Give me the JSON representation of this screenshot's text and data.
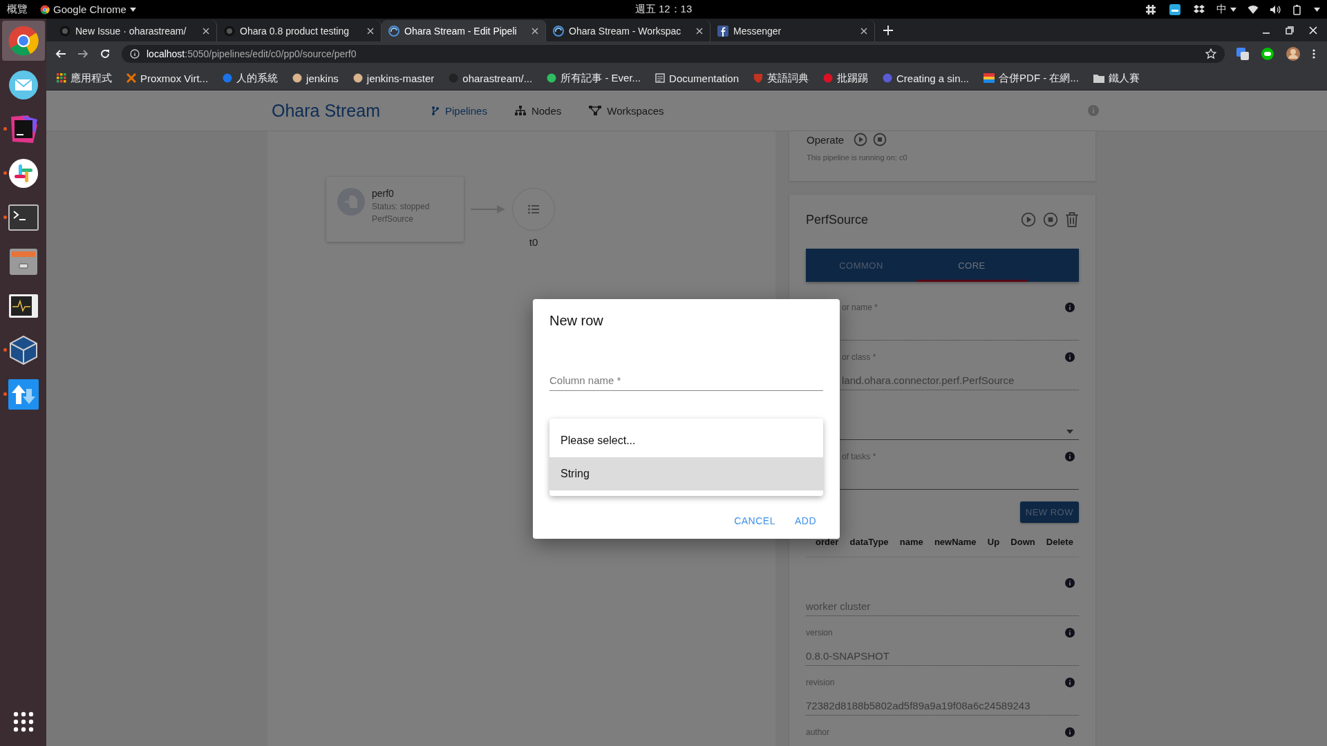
{
  "system_bar": {
    "activities": "概覽",
    "app_menu": "Google Chrome",
    "clock": "週五 12：13",
    "input_method": "中"
  },
  "browser": {
    "tabs": [
      {
        "title": "New Issue · oharastream/",
        "selected": false
      },
      {
        "title": "Ohara 0.8 product testing",
        "selected": false
      },
      {
        "title": "Ohara Stream - Edit Pipeli",
        "selected": true
      },
      {
        "title": "Ohara Stream - Workspac",
        "selected": false
      },
      {
        "title": "Messenger",
        "selected": false
      }
    ],
    "url_host": "localhost",
    "url_path": ":5050/pipelines/edit/c0/pp0/source/perf0",
    "bookmarks": [
      "應用程式",
      "Proxmox Virt...",
      "人的系統",
      "jenkins",
      "jenkins-master",
      "oharastream/...",
      "所有記事 - Ever...",
      "Documentation",
      "英語詞典",
      "批踢踢",
      "Creating a sin...",
      "合併PDF - 在網...",
      "鐵人賽"
    ]
  },
  "dock": {
    "apps": [
      {
        "kind": "chrome",
        "running": false,
        "selected": true
      },
      {
        "kind": "mail",
        "running": false,
        "selected": false
      },
      {
        "kind": "intellij",
        "running": true,
        "selected": false
      },
      {
        "kind": "slack",
        "running": true,
        "selected": false
      },
      {
        "kind": "terminal",
        "running": true,
        "selected": false
      },
      {
        "kind": "files",
        "running": false,
        "selected": false
      },
      {
        "kind": "monitor",
        "running": false,
        "selected": false
      },
      {
        "kind": "virtualbox",
        "running": true,
        "selected": false
      },
      {
        "kind": "transfer",
        "running": true,
        "selected": false
      }
    ]
  },
  "app": {
    "brand": "Ohara Stream",
    "nav": [
      {
        "label": "Pipelines",
        "selected": true
      },
      {
        "label": "Nodes",
        "selected": false
      },
      {
        "label": "Workspaces",
        "selected": false
      }
    ]
  },
  "pipeline_graph": {
    "connector": {
      "name": "perf0",
      "status": "Status: stopped",
      "type": "PerfSource"
    },
    "topic": {
      "name": "t0"
    }
  },
  "operate_card": {
    "title": "Operate",
    "note": "This pipeline is running on: c0"
  },
  "connector_panel": {
    "title": "PerfSource",
    "tabs": [
      {
        "label": "COMMON",
        "selected": false
      },
      {
        "label": "CORE",
        "selected": true
      }
    ],
    "fields": [
      {
        "kind": "partial",
        "label": "or name *",
        "dotted": true
      },
      {
        "kind": "partial",
        "label": "or class *",
        "value": "land.ohara.connector.perf.PerfSource",
        "dotted": true
      },
      {
        "kind": "select",
        "dotted": false
      },
      {
        "kind": "partial",
        "label": "of tasks *",
        "dotted": false
      },
      {
        "kind": "table",
        "button": "NEW ROW",
        "columns": [
          "order",
          "dataType",
          "name",
          "newName",
          "Up",
          "Down",
          "Delete"
        ]
      },
      {
        "kind": "text",
        "placeholder": "worker cluster",
        "dotted": true
      },
      {
        "kind": "text",
        "label": "version",
        "value": "0.8.0-SNAPSHOT",
        "dotted": true
      },
      {
        "kind": "text",
        "label": "revision",
        "value": "72382d8188b5802ad5f89a9a19f08a6c24589243",
        "dotted": true
      },
      {
        "kind": "text",
        "label": "author"
      }
    ]
  },
  "dialog": {
    "title": "New row",
    "field_placeholder": "Column name *",
    "options": [
      {
        "label": "Please select...",
        "selected": false
      },
      {
        "label": "String",
        "selected": true
      }
    ],
    "buttons": [
      "CANCEL",
      "ADD"
    ]
  }
}
